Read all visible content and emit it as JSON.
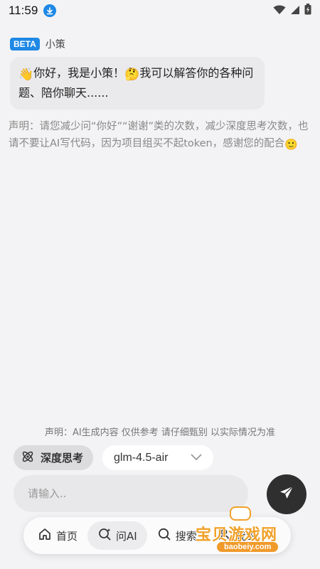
{
  "status_bar": {
    "time": "11:59",
    "icons": [
      "download-icon",
      "wifi-icon",
      "signal-icon",
      "battery-icon"
    ]
  },
  "bot": {
    "badge": "BETA",
    "name": "小策"
  },
  "greeting": {
    "part1": "你好，我是小策！",
    "part2": "我可以解答你的各种问题、陪你聊天......"
  },
  "disclaimer": "声明：请您减少问“你好”“谢谢”类的次数，减少深度思考次数，也请不要让AI写代码，因为项目组买不起token，感谢您的配合",
  "footer_note": "声明：AI生成内容 仅供参考 请仔细甄别 以实际情况为准",
  "controls": {
    "deep_think_label": "深度思考",
    "model_selected": "glm-4.5-air"
  },
  "input": {
    "placeholder": "请输入.."
  },
  "nav": {
    "items": [
      {
        "label": "首页",
        "icon": "home-icon",
        "active": false
      },
      {
        "label": "问AI",
        "icon": "ai-search-icon",
        "active": true
      },
      {
        "label": "搜索",
        "icon": "search-icon",
        "active": false
      },
      {
        "label": "我的",
        "icon": "profile-icon",
        "active": false
      }
    ]
  },
  "watermark": {
    "text": "宝贝游戏网",
    "url": "baobeiy.com"
  },
  "colors": {
    "accent": "#1e88e5",
    "background": "#f3f3f5",
    "send_button": "#2f2f2f",
    "watermark": "#f0a12a"
  }
}
